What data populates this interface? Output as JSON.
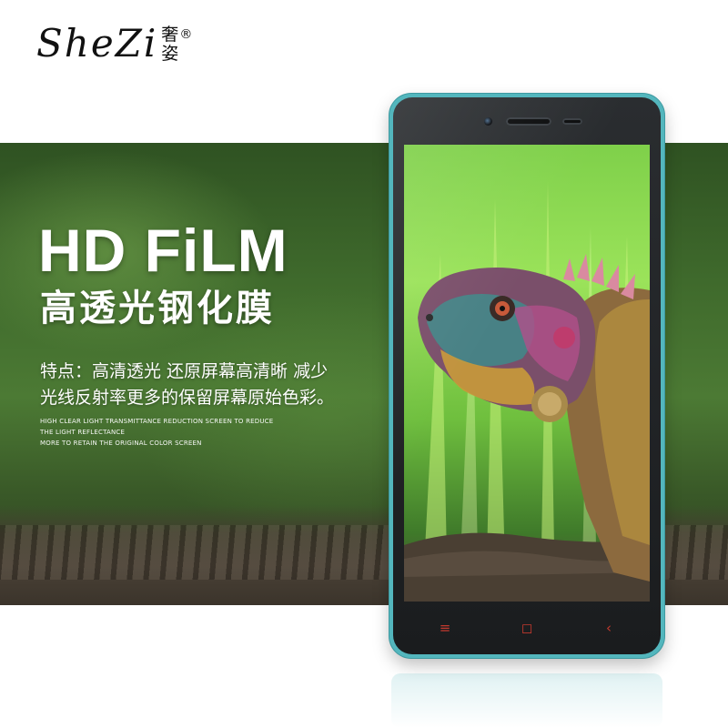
{
  "brand": {
    "latin": "SheZi",
    "cjk_top": "奢",
    "cjk_bottom": "姿",
    "registered": "®"
  },
  "banner": {
    "headline": "HD FiLM",
    "subtitle": "高透光钢化膜",
    "features_line1": "特点：高清透光 还原屏幕高清晰 减少",
    "features_line2": "光线反射率更多的保留屏幕原始色彩。",
    "en_line1": "HIGH CLEAR LIGHT TRANSMITTANCE REDUCTION SCREEN TO REDUCE",
    "en_line2": "THE LIGHT REFLECTANCE",
    "en_line3": "MORE TO RETAIN THE ORIGINAL COLOR SCREEN"
  },
  "phone": {
    "frame_color": "#53b6bd",
    "nav_icons": [
      "menu-icon",
      "home-icon",
      "back-icon"
    ],
    "nav_glyphs": [
      "≡",
      "◻",
      "‹"
    ],
    "nav_color": "#c2392e"
  },
  "colors": {
    "banner_green": "#3f6a2c",
    "text_white": "#ffffff"
  }
}
